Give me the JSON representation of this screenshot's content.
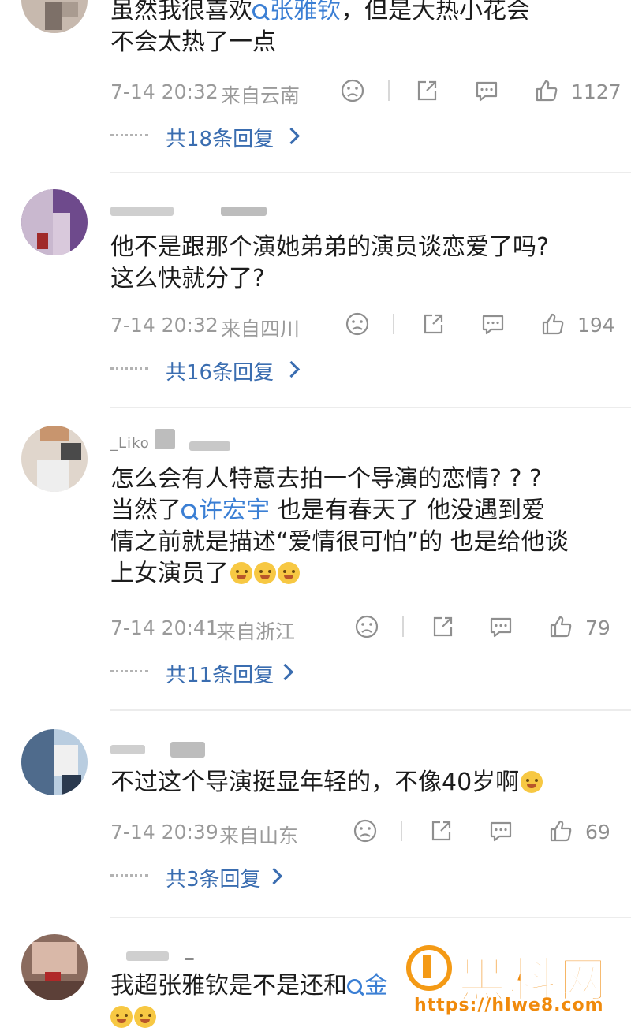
{
  "comments": [
    {
      "text_before": "虽然我很喜欢",
      "mention": "张雅钦",
      "text_after": "，但是大热小花会\n不会太热了一点",
      "time": "7-14 20:32",
      "location": "来自云南",
      "likes": "1127",
      "replies": "共18条回复"
    },
    {
      "name": "",
      "text": "他不是跟那个演她弟弟的演员谈恋爱了吗?\n这么快就分了?",
      "time": "7-14 20:32",
      "location": "来自四川",
      "likes": "194",
      "replies": "共16条回复"
    },
    {
      "name": "_Liko",
      "text_before": "怎么会有人特意去拍一个导演的恋情? ? ?\n当然了",
      "mention": "许宏宇",
      "text_after": " 也是有春天了 他没遇到爱\n情之前就是描述“爱情很可怕”的 也是给他谈\n上女演员了",
      "time": "7-14 20:41",
      "location": "来自浙江",
      "likes": "79",
      "replies": "共11条回复"
    },
    {
      "text": "不过这个导演挺显年轻的，不像40岁啊",
      "time": "7-14 20:39",
      "location": "来自山东",
      "likes": "69",
      "replies": "共3条回复"
    },
    {
      "text_before": "我超张雅钦是不是还和",
      "mention": "金",
      "text_after": ""
    }
  ],
  "icons": {
    "dislike": "frown-face-icon",
    "share": "share-icon",
    "comment": "comment-bubble-icon",
    "like": "thumbs-up-icon"
  },
  "colors": {
    "mention": "#3b7fd4",
    "reply_link": "#3a6db0",
    "meta": "#9a9a9a",
    "watermark": "#f08a0c"
  },
  "watermark": {
    "name": "黑料网",
    "url": "https://hlwe8.com"
  }
}
